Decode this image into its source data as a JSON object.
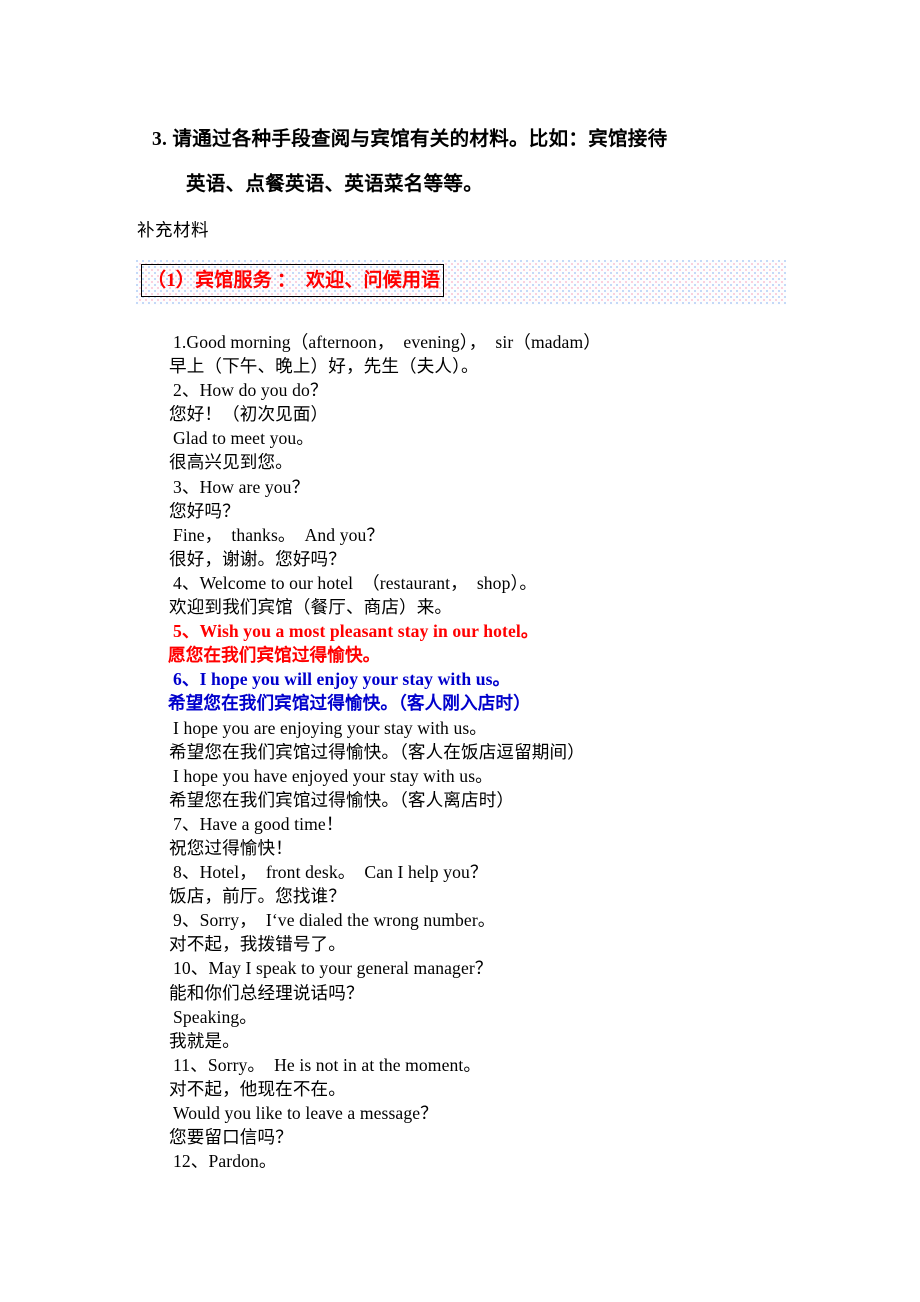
{
  "document": {
    "instruction": {
      "number": "3.",
      "line1": "3.  请通过各种手段查阅与宾馆有关的材料。比如：宾馆接待",
      "line2": "英语、点餐英语、英语菜名等等。"
    },
    "supplement_label": "补充材料",
    "section": {
      "heading": "（1）宾馆服务 ：  欢迎、问候用语",
      "heading_color": "#ff0000",
      "box_border_color": "#000000",
      "band_color": "#fdfdfe"
    },
    "colors": {
      "text": "#000000",
      "red": "#ff0000",
      "blue": "#0000cc"
    },
    "phrases": [
      {
        "text": "1.Good morning（afternoon，  evening），  sir（madam）",
        "lang": "en",
        "color": "black"
      },
      {
        "text": "早上（下午、晚上）好，先生（夫人）。",
        "lang": "zh",
        "color": "black"
      },
      {
        "text": "2、How do you do？",
        "lang": "en",
        "color": "black"
      },
      {
        "text": "您好！（初次见面）",
        "lang": "zh",
        "color": "black"
      },
      {
        "text": "Glad to meet you。",
        "lang": "en",
        "color": "black"
      },
      {
        "text": "很高兴见到您。",
        "lang": "zh",
        "color": "black"
      },
      {
        "text": "3、How are you？",
        "lang": "en",
        "color": "black"
      },
      {
        "text": "您好吗？",
        "lang": "zh",
        "color": "black"
      },
      {
        "text": "Fine，  thanks。  And you？",
        "lang": "en",
        "color": "black"
      },
      {
        "text": "很好，谢谢。您好吗？",
        "lang": "zh",
        "color": "black"
      },
      {
        "text": "4、Welcome to our hotel  （restaurant，  shop）。",
        "lang": "en",
        "color": "black"
      },
      {
        "text": "欢迎到我们宾馆（餐厅、商店）来。",
        "lang": "zh",
        "color": "black"
      },
      {
        "text": "5、Wish you a most pleasant stay in our hotel。",
        "lang": "en",
        "color": "red"
      },
      {
        "text": "愿您在我们宾馆过得愉快。",
        "lang": "zh",
        "color": "red"
      },
      {
        "text": "6、I hope you will enjoy your stay with us。",
        "lang": "en",
        "color": "blue"
      },
      {
        "text": "希望您在我们宾馆过得愉快。（客人刚入店时）",
        "lang": "zh",
        "color": "blue"
      },
      {
        "text": "I hope you are enjoying your stay with us。",
        "lang": "en",
        "color": "black"
      },
      {
        "text": "希望您在我们宾馆过得愉快。（客人在饭店逗留期间）",
        "lang": "zh",
        "color": "black"
      },
      {
        "text": "I hope you have enjoyed your stay with us。",
        "lang": "en",
        "color": "black"
      },
      {
        "text": "希望您在我们宾馆过得愉快。（客人离店时）",
        "lang": "zh",
        "color": "black"
      },
      {
        "text": "7、Have a good time！",
        "lang": "en",
        "color": "black"
      },
      {
        "text": "祝您过得愉快！",
        "lang": "zh",
        "color": "black"
      },
      {
        "text": "8、Hotel，  front desk。  Can I help you？",
        "lang": "en",
        "color": "black"
      },
      {
        "text": "饭店，前厅。您找谁？",
        "lang": "zh",
        "color": "black"
      },
      {
        "text": "9、Sorry，  I‘ve dialed the wrong number。",
        "lang": "en",
        "color": "black"
      },
      {
        "text": "对不起，我拨错号了。",
        "lang": "zh",
        "color": "black"
      },
      {
        "text": "10、May I speak to your general manager？",
        "lang": "en",
        "color": "black"
      },
      {
        "text": "能和你们总经理说话吗？",
        "lang": "zh",
        "color": "black"
      },
      {
        "text": "Speaking。",
        "lang": "en",
        "color": "black"
      },
      {
        "text": "我就是。",
        "lang": "zh",
        "color": "black"
      },
      {
        "text": "11、Sorry。  He is not in at the moment。",
        "lang": "en",
        "color": "black"
      },
      {
        "text": "对不起，他现在不在。",
        "lang": "zh",
        "color": "black"
      },
      {
        "text": "Would you like to leave a message？",
        "lang": "en",
        "color": "black"
      },
      {
        "text": "您要留口信吗？",
        "lang": "zh",
        "color": "black"
      },
      {
        "text": "12、Pardon。",
        "lang": "en",
        "color": "black"
      }
    ]
  }
}
